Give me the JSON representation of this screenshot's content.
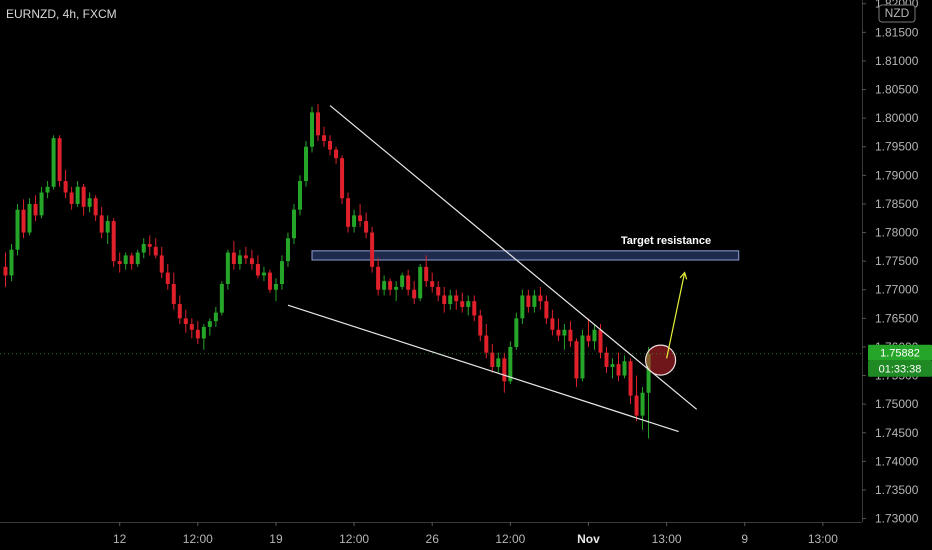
{
  "header": {
    "title": "EURNZD, 4h, FXCM"
  },
  "currency_badge": "NZD",
  "annotation": {
    "label": "Target resistance"
  },
  "price_tag": {
    "price": "1.75882",
    "countdown": "01:33:38"
  },
  "colors": {
    "up": "#26a629",
    "down": "#e0202b",
    "background": "#000000",
    "zone": "#2a3a66",
    "arrow": "#e6f03a",
    "circle": "#c8282e"
  },
  "chart_data": {
    "type": "candlestick",
    "symbol": "EURNZD",
    "timeframe": "4h",
    "source": "FXCM",
    "y_ticks": [
      "1.82000",
      "1.81500",
      "1.81000",
      "1.80500",
      "1.80000",
      "1.79500",
      "1.79000",
      "1.78500",
      "1.78000",
      "1.77500",
      "1.77000",
      "1.76500",
      "1.76000",
      "1.75500",
      "1.75000",
      "1.74500",
      "1.74000",
      "1.73500",
      "1.73000"
    ],
    "y_range": [
      1.728,
      1.821
    ],
    "x_ticks": [
      {
        "label": "12",
        "idx": 19,
        "bold": false
      },
      {
        "label": "12:00",
        "idx": 32,
        "bold": false
      },
      {
        "label": "19",
        "idx": 45,
        "bold": false
      },
      {
        "label": "12:00",
        "idx": 58,
        "bold": false
      },
      {
        "label": "26",
        "idx": 71,
        "bold": false
      },
      {
        "label": "12:00",
        "idx": 84,
        "bold": false
      },
      {
        "label": "Nov",
        "idx": 97,
        "bold": true
      },
      {
        "label": "13:00",
        "idx": 110,
        "bold": false
      },
      {
        "label": "9",
        "idx": 123,
        "bold": false
      },
      {
        "label": "13:00",
        "idx": 136,
        "bold": false
      }
    ],
    "last_price": 1.75882,
    "resistance_zone": [
      1.7752,
      1.7768
    ],
    "trendlines": [
      {
        "from": [
          54,
          1.8022
        ],
        "to": [
          115,
          1.7491
        ]
      },
      {
        "from": [
          47,
          1.7673
        ],
        "to": [
          112,
          1.7452
        ]
      }
    ],
    "projection_arrow": {
      "from": [
        110,
        1.758
      ],
      "to": [
        113,
        1.773
      ]
    },
    "breakout_circle": {
      "idx": 109,
      "price": 1.7577
    },
    "ohlc": [
      [
        1.774,
        1.7765,
        1.7705,
        1.7725
      ],
      [
        1.7725,
        1.778,
        1.7715,
        1.777
      ],
      [
        1.777,
        1.785,
        1.776,
        1.784
      ],
      [
        1.784,
        1.7858,
        1.779,
        1.78
      ],
      [
        1.78,
        1.786,
        1.7795,
        1.785
      ],
      [
        1.785,
        1.7865,
        1.782,
        1.783
      ],
      [
        1.783,
        1.788,
        1.7825,
        1.787
      ],
      [
        1.787,
        1.789,
        1.786,
        1.788
      ],
      [
        1.788,
        1.797,
        1.7875,
        1.7965
      ],
      [
        1.7965,
        1.797,
        1.788,
        1.789
      ],
      [
        1.789,
        1.791,
        1.786,
        1.787
      ],
      [
        1.787,
        1.788,
        1.784,
        1.785
      ],
      [
        1.785,
        1.789,
        1.7845,
        1.788
      ],
      [
        1.788,
        1.7885,
        1.783,
        1.7845
      ],
      [
        1.7845,
        1.787,
        1.7835,
        1.786
      ],
      [
        1.786,
        1.7865,
        1.782,
        1.783
      ],
      [
        1.783,
        1.7845,
        1.779,
        1.78
      ],
      [
        1.78,
        1.783,
        1.778,
        1.782
      ],
      [
        1.782,
        1.7825,
        1.774,
        1.775
      ],
      [
        1.775,
        1.7765,
        1.773,
        1.7745
      ],
      [
        1.7745,
        1.7765,
        1.7735,
        1.776
      ],
      [
        1.776,
        1.7765,
        1.7735,
        1.7745
      ],
      [
        1.7745,
        1.777,
        1.774,
        1.7765
      ],
      [
        1.7765,
        1.779,
        1.7755,
        1.778
      ],
      [
        1.778,
        1.7795,
        1.776,
        1.7775
      ],
      [
        1.7775,
        1.779,
        1.7755,
        1.776
      ],
      [
        1.776,
        1.7775,
        1.772,
        1.773
      ],
      [
        1.773,
        1.7745,
        1.77,
        1.771
      ],
      [
        1.771,
        1.773,
        1.7665,
        1.7675
      ],
      [
        1.7675,
        1.769,
        1.764,
        1.765
      ],
      [
        1.765,
        1.7665,
        1.7625,
        1.764
      ],
      [
        1.764,
        1.765,
        1.7615,
        1.763
      ],
      [
        1.763,
        1.7645,
        1.7605,
        1.7615
      ],
      [
        1.7615,
        1.764,
        1.7595,
        1.7635
      ],
      [
        1.7635,
        1.765,
        1.762,
        1.7645
      ],
      [
        1.7645,
        1.767,
        1.7635,
        1.766
      ],
      [
        1.766,
        1.7715,
        1.7655,
        1.771
      ],
      [
        1.771,
        1.777,
        1.77,
        1.7765
      ],
      [
        1.7765,
        1.7785,
        1.7735,
        1.7745
      ],
      [
        1.7745,
        1.777,
        1.7735,
        1.776
      ],
      [
        1.776,
        1.7775,
        1.7745,
        1.7755
      ],
      [
        1.7755,
        1.777,
        1.7735,
        1.7745
      ],
      [
        1.7745,
        1.776,
        1.772,
        1.7725
      ],
      [
        1.7725,
        1.774,
        1.7715,
        1.773
      ],
      [
        1.773,
        1.7735,
        1.7695,
        1.77
      ],
      [
        1.77,
        1.772,
        1.768,
        1.771
      ],
      [
        1.771,
        1.776,
        1.77,
        1.775
      ],
      [
        1.775,
        1.78,
        1.774,
        1.779
      ],
      [
        1.779,
        1.785,
        1.778,
        1.784
      ],
      [
        1.784,
        1.79,
        1.783,
        1.789
      ],
      [
        1.789,
        1.796,
        1.788,
        1.795
      ],
      [
        1.795,
        1.802,
        1.794,
        1.801
      ],
      [
        1.801,
        1.8025,
        1.796,
        1.797
      ],
      [
        1.797,
        1.7985,
        1.795,
        1.796
      ],
      [
        1.796,
        1.797,
        1.7935,
        1.7945
      ],
      [
        1.7945,
        1.795,
        1.792,
        1.793
      ],
      [
        1.793,
        1.7935,
        1.785,
        1.786
      ],
      [
        1.786,
        1.787,
        1.78,
        1.781
      ],
      [
        1.781,
        1.784,
        1.78,
        1.783
      ],
      [
        1.783,
        1.785,
        1.781,
        1.782
      ],
      [
        1.782,
        1.7835,
        1.779,
        1.78
      ],
      [
        1.78,
        1.781,
        1.773,
        1.774
      ],
      [
        1.774,
        1.7755,
        1.769,
        1.77
      ],
      [
        1.77,
        1.7725,
        1.769,
        1.7715
      ],
      [
        1.7715,
        1.772,
        1.769,
        1.77
      ],
      [
        1.77,
        1.7715,
        1.768,
        1.7705
      ],
      [
        1.7705,
        1.773,
        1.77,
        1.7725
      ],
      [
        1.7725,
        1.7735,
        1.769,
        1.77
      ],
      [
        1.77,
        1.7715,
        1.7675,
        1.7685
      ],
      [
        1.7685,
        1.7745,
        1.768,
        1.774
      ],
      [
        1.774,
        1.776,
        1.7705,
        1.7715
      ],
      [
        1.7715,
        1.773,
        1.7695,
        1.7705
      ],
      [
        1.7705,
        1.7715,
        1.768,
        1.769
      ],
      [
        1.769,
        1.7705,
        1.766,
        1.7675
      ],
      [
        1.7675,
        1.77,
        1.7665,
        1.769
      ],
      [
        1.769,
        1.77,
        1.7665,
        1.768
      ],
      [
        1.768,
        1.7695,
        1.766,
        1.767
      ],
      [
        1.767,
        1.769,
        1.7655,
        1.768
      ],
      [
        1.768,
        1.769,
        1.7645,
        1.7655
      ],
      [
        1.7655,
        1.7665,
        1.761,
        1.762
      ],
      [
        1.762,
        1.764,
        1.758,
        1.759
      ],
      [
        1.759,
        1.7605,
        1.7555,
        1.7565
      ],
      [
        1.7565,
        1.759,
        1.7555,
        1.758
      ],
      [
        1.758,
        1.759,
        1.752,
        1.754
      ],
      [
        1.754,
        1.761,
        1.7535,
        1.76
      ],
      [
        1.76,
        1.766,
        1.7595,
        1.765
      ],
      [
        1.765,
        1.77,
        1.764,
        1.769
      ],
      [
        1.769,
        1.77,
        1.766,
        1.767
      ],
      [
        1.767,
        1.77,
        1.766,
        1.769
      ],
      [
        1.769,
        1.7705,
        1.7665,
        1.768
      ],
      [
        1.768,
        1.769,
        1.764,
        1.765
      ],
      [
        1.765,
        1.7665,
        1.762,
        1.763
      ],
      [
        1.763,
        1.765,
        1.761,
        1.762
      ],
      [
        1.762,
        1.764,
        1.7595,
        1.763
      ],
      [
        1.763,
        1.7645,
        1.76,
        1.761
      ],
      [
        1.761,
        1.7615,
        1.753,
        1.7545
      ],
      [
        1.7545,
        1.763,
        1.754,
        1.762
      ],
      [
        1.762,
        1.765,
        1.76,
        1.761
      ],
      [
        1.761,
        1.764,
        1.7595,
        1.763
      ],
      [
        1.763,
        1.764,
        1.758,
        1.759
      ],
      [
        1.759,
        1.76,
        1.7555,
        1.7565
      ],
      [
        1.7565,
        1.758,
        1.7545,
        1.757
      ],
      [
        1.757,
        1.759,
        1.754,
        1.755
      ],
      [
        1.755,
        1.7585,
        1.7545,
        1.7575
      ],
      [
        1.7575,
        1.758,
        1.75,
        1.7515
      ],
      [
        1.7515,
        1.755,
        1.747,
        1.748
      ],
      [
        1.748,
        1.753,
        1.7455,
        1.752
      ],
      [
        1.752,
        1.76,
        1.744,
        1.7588
      ]
    ]
  }
}
